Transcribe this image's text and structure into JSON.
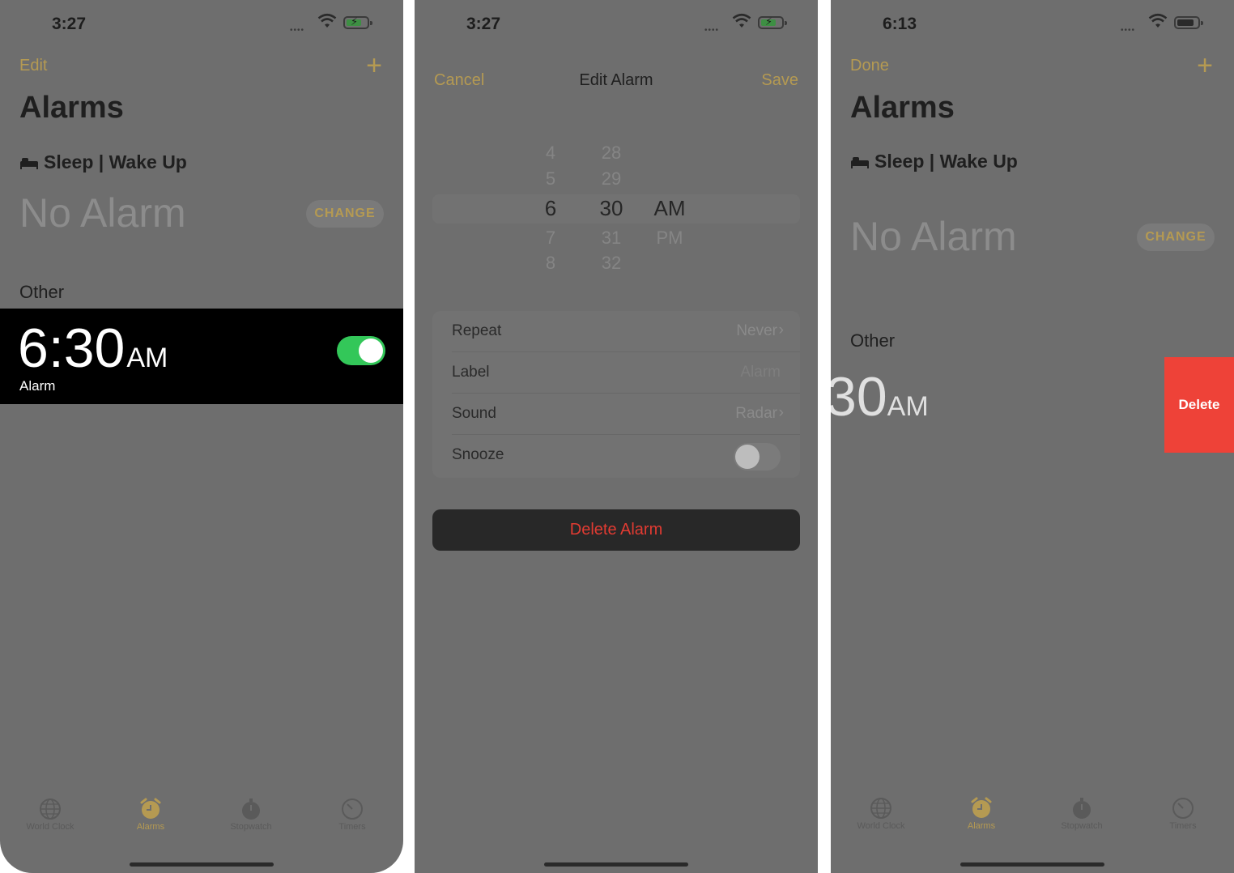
{
  "screen1": {
    "status_time": "3:27",
    "edit": "Edit",
    "title": "Alarms",
    "sleep_label": "Sleep | Wake Up",
    "no_alarm": "No Alarm",
    "change": "CHANGE",
    "other": "Other",
    "alarm_time": "6:30",
    "alarm_ampm": "AM",
    "alarm_label": "Alarm",
    "alarm_enabled": true
  },
  "screen2": {
    "status_time": "3:27",
    "cancel": "Cancel",
    "title": "Edit Alarm",
    "save": "Save",
    "picker": {
      "hours": [
        "4",
        "5",
        "6",
        "7",
        "8"
      ],
      "minutes": [
        "28",
        "29",
        "30",
        "31",
        "32"
      ],
      "periods": [
        "AM",
        "PM"
      ],
      "selected_hour": "6",
      "selected_minute": "30",
      "selected_period": "AM"
    },
    "settings": [
      {
        "key": "Repeat",
        "value": "Never"
      },
      {
        "key": "Label",
        "value": "Alarm"
      },
      {
        "key": "Sound",
        "value": "Radar"
      },
      {
        "key": "Snooze",
        "value": ""
      }
    ],
    "snooze_enabled": false,
    "delete_alarm": "Delete Alarm"
  },
  "screen3": {
    "status_time": "6:13",
    "done": "Done",
    "title": "Alarms",
    "sleep_label": "Sleep | Wake Up",
    "no_alarm": "No Alarm",
    "change": "CHANGE",
    "other": "Other",
    "alarm_time_partial": "30",
    "alarm_ampm": "AM",
    "delete": "Delete"
  },
  "tabs": [
    "World Clock",
    "Alarms",
    "Stopwatch",
    "Timers"
  ],
  "active_tab": "Alarms",
  "colors": {
    "accent": "#b59a52",
    "toggle_on": "#33c759",
    "delete_red": "#ee4238",
    "overlay_gray": "#6e6e6e"
  }
}
